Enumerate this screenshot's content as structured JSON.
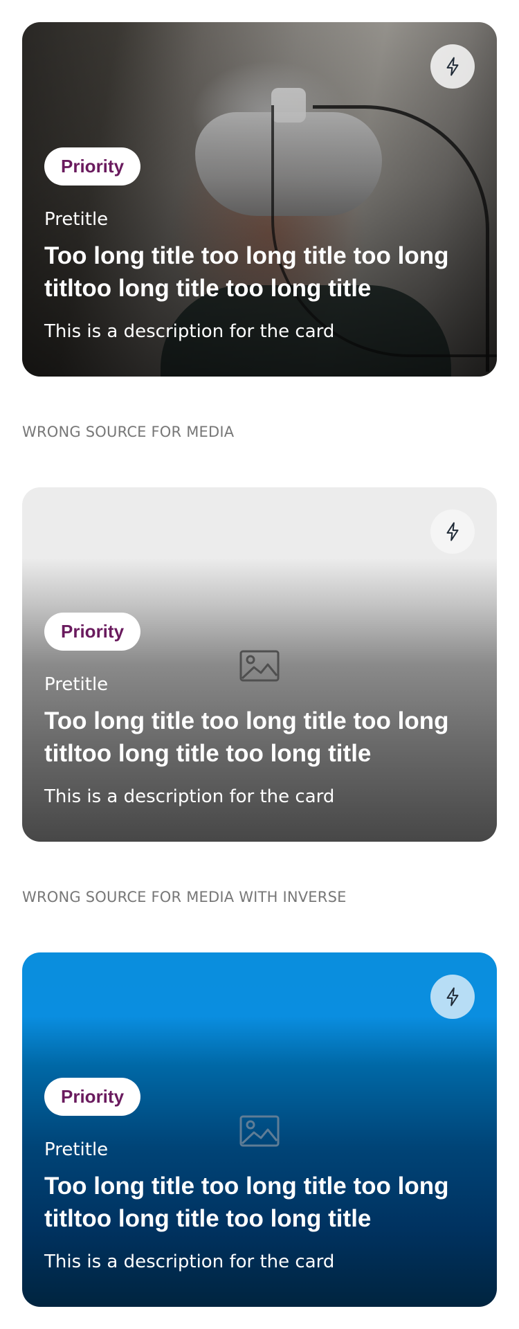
{
  "cards": [
    {
      "badge": "Priority",
      "pretitle": "Pretitle",
      "title": "Too long title too long title too long titltoo long title too long title",
      "description": "This is a description for the card",
      "icon": "flash-icon"
    },
    {
      "badge": "Priority",
      "pretitle": "Pretitle",
      "title": "Too long title too long title too long titltoo long title too long title",
      "description": "This is a description for the card",
      "icon": "flash-icon",
      "media_icon": "image-placeholder-icon"
    },
    {
      "badge": "Priority",
      "pretitle": "Pretitle",
      "title": "Too long title too long title too long titltoo long title too long title",
      "description": "This is a description for the card",
      "icon": "flash-icon",
      "media_icon": "image-placeholder-icon"
    }
  ],
  "section_labels": {
    "wrong_source": "WRONG SOURCE FOR MEDIA",
    "wrong_source_inverse": "WRONG SOURCE FOR MEDIA WITH INVERSE"
  },
  "colors": {
    "badge_text": "#6a1b5e",
    "inverse_blue": "#0a8edd",
    "label_gray": "#777777"
  }
}
